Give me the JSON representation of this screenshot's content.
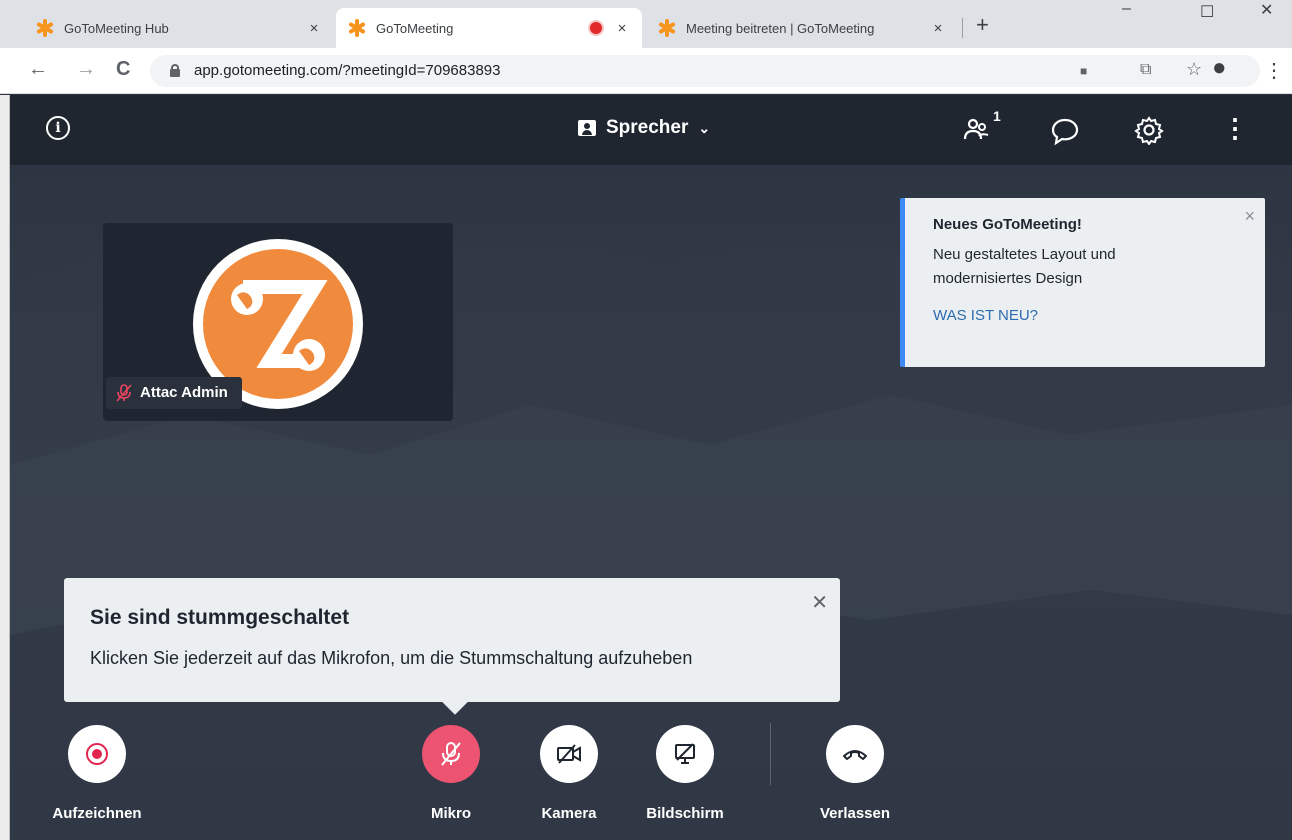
{
  "browser": {
    "tabs": [
      {
        "title": "GoToMeeting Hub",
        "close": "×"
      },
      {
        "title": "GoToMeeting",
        "close": "×"
      },
      {
        "title": "Meeting beitreten | GoToMeeting",
        "close": "×"
      }
    ],
    "new_tab": "+",
    "url": "app.gotomeeting.com/?meetingId=709683893",
    "nav": {
      "back": "←",
      "forward": "→",
      "reload": "C"
    },
    "window_controls": {
      "minimize": "–",
      "maximize": "☐",
      "close": "✕"
    },
    "omnibox_icons": {
      "camera": "■",
      "translate": "⧉",
      "star": "☆",
      "profile": "●",
      "menu": "⋮"
    }
  },
  "header": {
    "info_icon": "i",
    "view_label": "Sprecher",
    "view_chevron": "⌄",
    "participants_count": "1",
    "participants_icon": "people-icon",
    "chat_icon": "chat-icon",
    "settings_icon": "gear-icon",
    "more_icon": "⋮"
  },
  "tile": {
    "name": "Attac Admin",
    "mic_icon": "mic-off-icon",
    "mic_glyph": "🎙"
  },
  "whats_new": {
    "title": "Neues GoToMeeting!",
    "body": "Neu gestaltetes Layout und modernisiertes Design",
    "link": "WAS IST NEU?",
    "close": "×"
  },
  "mute_tip": {
    "title": "Sie sind stummgeschaltet",
    "body": "Klicken Sie jederzeit auf das Mikrofon, um die Stummschaltung aufzuheben",
    "close": "✕"
  },
  "controls": [
    {
      "label": "Aufzeichnen",
      "icon": "record-icon"
    },
    {
      "label": "Mikro",
      "icon": "mic-off-icon"
    },
    {
      "label": "Kamera",
      "icon": "camera-off-icon"
    },
    {
      "label": "Bildschirm",
      "icon": "screen-share-off-icon"
    },
    {
      "label": "Verlassen",
      "icon": "hang-up-icon"
    }
  ],
  "colors": {
    "brand_orange": "#f7941d",
    "mute_red": "#ec5472",
    "link_blue": "#2b6cb0",
    "accent_blue": "#3d8af7",
    "header_bg": "#1f2630"
  }
}
